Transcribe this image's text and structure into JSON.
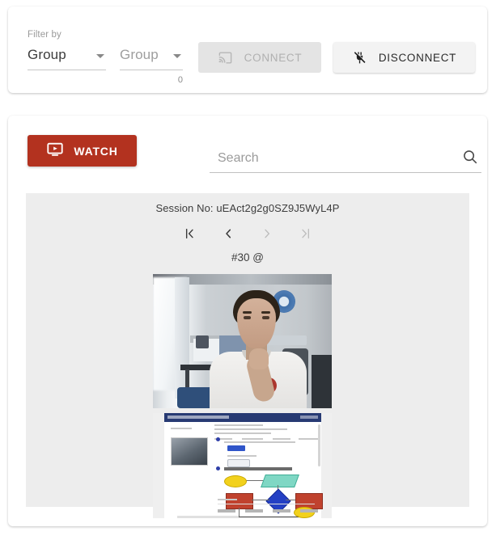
{
  "filter_card": {
    "label": "Filter by",
    "select_group_primary": {
      "value": "Group",
      "icon": "chevron-down-icon"
    },
    "select_group_secondary": {
      "value": "Group",
      "icon": "chevron-down-icon"
    },
    "counter": "0",
    "connect_button": {
      "label": "CONNECT",
      "icon": "screen-cast-icon",
      "state": "disabled"
    },
    "disconnect_button": {
      "label": "DISCONNECT",
      "icon": "plug-off-icon",
      "state": "enabled"
    }
  },
  "session_card": {
    "watch_button": {
      "label": "WATCH",
      "icon": "monitor-play-icon",
      "color": "#b3321f"
    },
    "search": {
      "value": "",
      "placeholder": "Search",
      "icon": "search-icon"
    },
    "viewer": {
      "session_no": "Session No: uEAct2g2g0SZ9J5WyL4P",
      "frame_caption": "#30 @",
      "pager": [
        {
          "name": "first-page",
          "glyph": "|‹",
          "state": "enabled"
        },
        {
          "name": "previous-page",
          "glyph": "‹",
          "state": "enabled"
        },
        {
          "name": "next-page",
          "glyph": "›",
          "state": "disabled"
        },
        {
          "name": "last-page",
          "glyph": "›|",
          "state": "disabled"
        }
      ],
      "webcam_snapshot_alt": "webcam snapshot of a person seated in a room",
      "screen_snapshot_alt": "screen capture of a web page showing a flowchart diagram"
    }
  }
}
